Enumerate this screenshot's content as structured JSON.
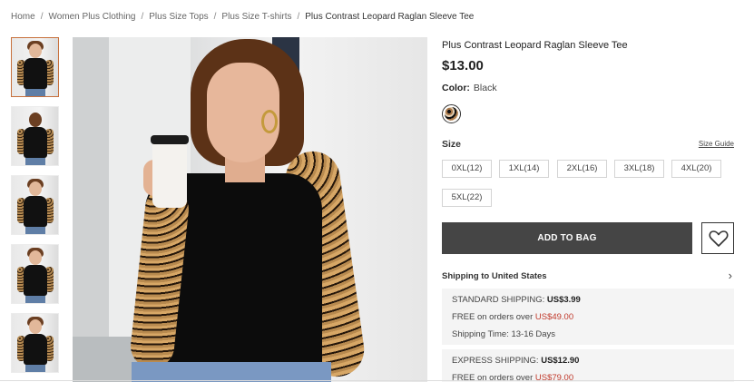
{
  "breadcrumb": {
    "items": [
      "Home",
      "Women Plus Clothing",
      "Plus Size Tops",
      "Plus Size T-shirts",
      "Plus Contrast Leopard Raglan Sleeve Tee"
    ],
    "separator": "/"
  },
  "product": {
    "title": "Plus Contrast Leopard Raglan Sleeve Tee",
    "price": "$13.00",
    "color_label": "Color:",
    "color_value": "Black"
  },
  "sizes": {
    "heading": "Size",
    "guide_label": "Size Guide",
    "options": [
      "0XL(12)",
      "1XL(14)",
      "2XL(16)",
      "3XL(18)",
      "4XL(20)",
      "5XL(22)"
    ]
  },
  "actions": {
    "add_to_bag": "ADD TO BAG"
  },
  "shipping": {
    "heading": "Shipping to United States",
    "standard": {
      "label": "STANDARD SHIPPING:",
      "price": "US$3.99",
      "free_prefix": "FREE on orders over",
      "free_threshold": "US$49.00",
      "time": "Shipping Time: 13-16 Days"
    },
    "express": {
      "label": "EXPRESS SHIPPING:",
      "price": "US$12.90",
      "free_prefix": "FREE on orders over",
      "free_threshold": "US$79.00"
    }
  },
  "colors": {
    "button_bg": "#454545",
    "price_red": "#c0392b",
    "thumb_active_border": "#c7703c"
  }
}
